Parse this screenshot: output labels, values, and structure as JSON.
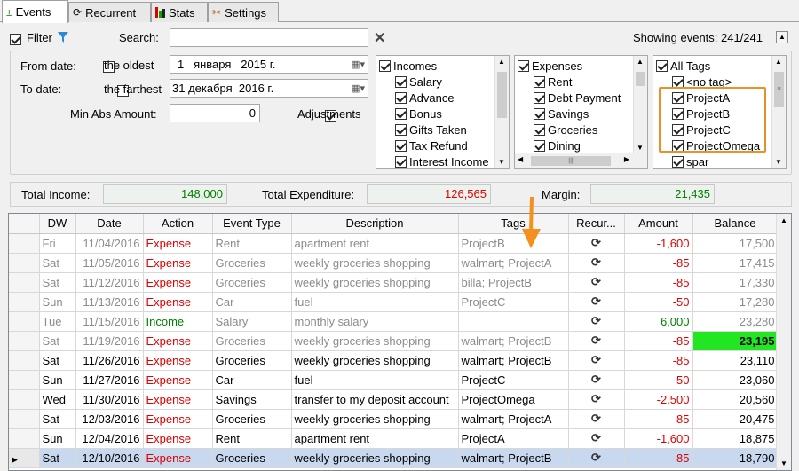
{
  "tabs": [
    {
      "label": "Events"
    },
    {
      "label": "Recurrent"
    },
    {
      "label": "Stats"
    },
    {
      "label": "Settings"
    }
  ],
  "filter": {
    "label": "Filter",
    "search_label": "Search:",
    "search_value": "",
    "showing": "Showing events: 241/241"
  },
  "dates": {
    "from_label": "From date:",
    "oldest_label": "the oldest",
    "from_value": "1   января   2015 г.",
    "to_label": "To date:",
    "farthest_label": "the farthest",
    "to_value": "31 декабря  2016 г."
  },
  "amount": {
    "label": "Min Abs Amount:",
    "value": "0",
    "adjustments_label": "Adjustments"
  },
  "incomes": {
    "header": "Incomes",
    "items": [
      "Salary",
      "Advance",
      "Bonus",
      "Gifts Taken",
      "Tax Refund",
      "Interest Income"
    ]
  },
  "expenses": {
    "header": "Expenses",
    "items": [
      "Rent",
      "Debt Payment",
      "Savings",
      "Groceries",
      "Dining"
    ]
  },
  "tags": {
    "header": "All Tags",
    "items": [
      "<no tag>",
      "ProjectA",
      "ProjectB",
      "ProjectC",
      "ProjectOmega",
      "spar"
    ]
  },
  "totals": {
    "income_label": "Total Income:",
    "income_value": "148,000",
    "expenditure_label": "Total Expenditure:",
    "expenditure_value": "126,565",
    "margin_label": "Margin:",
    "margin_value": "21,435"
  },
  "colors": {
    "income": "#008000",
    "expense": "#e00000",
    "highlight_border": "#e8902a",
    "balance_highlight": "#22e622",
    "selected_row": "#c8d8ef",
    "arrow": "#f5901e"
  },
  "table": {
    "columns": [
      "DW",
      "Date",
      "Action",
      "Event Type",
      "Description",
      "Tags",
      "Recur...",
      "Amount",
      "Balance"
    ],
    "rows": [
      {
        "dw": "Fri",
        "date": "11/04/2016",
        "action": "Expense",
        "type": "Rent",
        "desc": "apartment rent",
        "tags": "ProjectB",
        "amount": "-1,600",
        "balance": "17,500",
        "past": true
      },
      {
        "dw": "Sat",
        "date": "11/05/2016",
        "action": "Expense",
        "type": "Groceries",
        "desc": "weekly groceries shopping",
        "tags": "walmart; ProjectA",
        "amount": "-85",
        "balance": "17,415",
        "past": true
      },
      {
        "dw": "Sat",
        "date": "11/12/2016",
        "action": "Expense",
        "type": "Groceries",
        "desc": "weekly groceries shopping",
        "tags": "billa; ProjectB",
        "amount": "-85",
        "balance": "17,330",
        "past": true
      },
      {
        "dw": "Sun",
        "date": "11/13/2016",
        "action": "Expense",
        "type": "Car",
        "desc": "fuel",
        "tags": "ProjectC",
        "amount": "-50",
        "balance": "17,280",
        "past": true
      },
      {
        "dw": "Tue",
        "date": "11/15/2016",
        "action": "Income",
        "type": "Salary",
        "desc": "monthly salary",
        "tags": "",
        "amount": "6,000",
        "balance": "23,280",
        "past": true
      },
      {
        "dw": "Sat",
        "date": "11/19/2016",
        "action": "Expense",
        "type": "Groceries",
        "desc": "weekly groceries shopping",
        "tags": "walmart; ProjectB",
        "amount": "-85",
        "balance": "23,195",
        "past": true,
        "highlight": true
      },
      {
        "dw": "Sat",
        "date": "11/26/2016",
        "action": "Expense",
        "type": "Groceries",
        "desc": "weekly groceries shopping",
        "tags": "walmart; ProjectB",
        "amount": "-85",
        "balance": "23,110"
      },
      {
        "dw": "Sun",
        "date": "11/27/2016",
        "action": "Expense",
        "type": "Car",
        "desc": "fuel",
        "tags": "ProjectC",
        "amount": "-50",
        "balance": "23,060"
      },
      {
        "dw": "Wed",
        "date": "11/30/2016",
        "action": "Expense",
        "type": "Savings",
        "desc": "transfer to my deposit account",
        "tags": "ProjectOmega",
        "amount": "-2,500",
        "balance": "20,560"
      },
      {
        "dw": "Sat",
        "date": "12/03/2016",
        "action": "Expense",
        "type": "Groceries",
        "desc": "weekly groceries shopping",
        "tags": "walmart; ProjectA",
        "amount": "-85",
        "balance": "20,475"
      },
      {
        "dw": "Sun",
        "date": "12/04/2016",
        "action": "Expense",
        "type": "Rent",
        "desc": "apartment rent",
        "tags": "ProjectA",
        "amount": "-1,600",
        "balance": "18,875"
      },
      {
        "dw": "Sat",
        "date": "12/10/2016",
        "action": "Expense",
        "type": "Groceries",
        "desc": "weekly groceries shopping",
        "tags": "walmart; ProjectB",
        "amount": "-85",
        "balance": "18,790",
        "selected": true
      }
    ]
  }
}
